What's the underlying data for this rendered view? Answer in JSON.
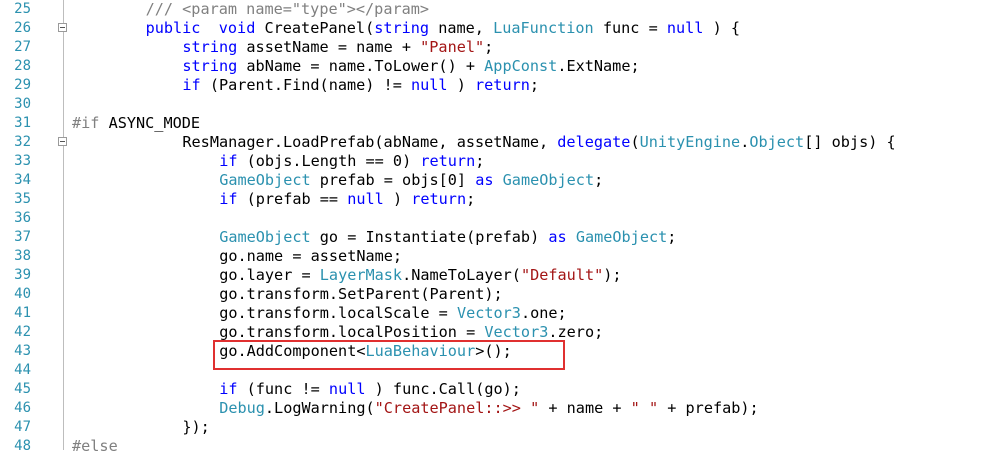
{
  "editor": {
    "lines": [
      {
        "number": "25",
        "indent": 8,
        "fold": false,
        "tokens": [
          [
            "cm",
            "/// <param name=\"type\"></param>"
          ]
        ]
      },
      {
        "number": "26",
        "indent": 8,
        "fold": true,
        "tokens": [
          [
            "kw",
            "public"
          ],
          [
            "",
            "  "
          ],
          [
            "kw",
            "void"
          ],
          [
            "",
            " CreatePanel("
          ],
          [
            "kw",
            "string"
          ],
          [
            "",
            " name, "
          ],
          [
            "ty",
            "LuaFunction"
          ],
          [
            "",
            " func = "
          ],
          [
            "kw",
            "null"
          ],
          [
            "",
            " ) {"
          ]
        ]
      },
      {
        "number": "27",
        "indent": 12,
        "fold": false,
        "tokens": [
          [
            "kw",
            "string"
          ],
          [
            "",
            " assetName = name + "
          ],
          [
            "st",
            "\"Panel\""
          ],
          [
            "",
            ";"
          ]
        ]
      },
      {
        "number": "28",
        "indent": 12,
        "fold": false,
        "tokens": [
          [
            "kw",
            "string"
          ],
          [
            "",
            " abName = name.ToLower() + "
          ],
          [
            "ty",
            "AppConst"
          ],
          [
            "",
            ".ExtName;"
          ]
        ]
      },
      {
        "number": "29",
        "indent": 12,
        "fold": false,
        "tokens": [
          [
            "kw",
            "if"
          ],
          [
            "",
            " (Parent.Find(name) != "
          ],
          [
            "kw",
            "null"
          ],
          [
            "",
            " ) "
          ],
          [
            "kw",
            "return"
          ],
          [
            "",
            ";"
          ]
        ]
      },
      {
        "number": "30",
        "indent": 0,
        "fold": false,
        "tokens": []
      },
      {
        "number": "31",
        "indent": 0,
        "fold": false,
        "tokens": [
          [
            "pp",
            "#if"
          ],
          [
            "",
            " ASYNC_MODE"
          ]
        ]
      },
      {
        "number": "32",
        "indent": 12,
        "fold": true,
        "tokens": [
          [
            "",
            "ResManager.LoadPrefab(abName, assetName, "
          ],
          [
            "kw",
            "delegate"
          ],
          [
            "",
            "("
          ],
          [
            "ty",
            "UnityEngine"
          ],
          [
            "",
            "."
          ],
          [
            "ty",
            "Object"
          ],
          [
            "",
            "[] objs) {"
          ]
        ]
      },
      {
        "number": "33",
        "indent": 16,
        "fold": false,
        "tokens": [
          [
            "kw",
            "if"
          ],
          [
            "",
            " (objs.Length == 0) "
          ],
          [
            "kw",
            "return"
          ],
          [
            "",
            ";"
          ]
        ]
      },
      {
        "number": "34",
        "indent": 16,
        "fold": false,
        "tokens": [
          [
            "ty",
            "GameObject"
          ],
          [
            "",
            " prefab = objs[0] "
          ],
          [
            "kw",
            "as"
          ],
          [
            "",
            ""
          ],
          [
            "ty",
            " GameObject"
          ],
          [
            "",
            ";"
          ]
        ]
      },
      {
        "number": "35",
        "indent": 16,
        "fold": false,
        "tokens": [
          [
            "kw",
            "if"
          ],
          [
            "",
            " (prefab == "
          ],
          [
            "kw",
            "null"
          ],
          [
            "",
            " ) "
          ],
          [
            "kw",
            "return"
          ],
          [
            "",
            ";"
          ]
        ]
      },
      {
        "number": "36",
        "indent": 0,
        "fold": false,
        "tokens": []
      },
      {
        "number": "37",
        "indent": 16,
        "fold": false,
        "tokens": [
          [
            "ty",
            "GameObject"
          ],
          [
            "",
            " go = Instantiate(prefab) "
          ],
          [
            "kw",
            "as"
          ],
          [
            "ty",
            " GameObject"
          ],
          [
            "",
            ";"
          ]
        ]
      },
      {
        "number": "38",
        "indent": 16,
        "fold": false,
        "tokens": [
          [
            "",
            "go.name = assetName;"
          ]
        ]
      },
      {
        "number": "39",
        "indent": 16,
        "fold": false,
        "tokens": [
          [
            "",
            "go.layer = "
          ],
          [
            "ty",
            "LayerMask"
          ],
          [
            "",
            ".NameToLayer("
          ],
          [
            "st",
            "\"Default\""
          ],
          [
            "",
            ");"
          ]
        ]
      },
      {
        "number": "40",
        "indent": 16,
        "fold": false,
        "tokens": [
          [
            "",
            "go.transform.SetParent(Parent);"
          ]
        ]
      },
      {
        "number": "41",
        "indent": 16,
        "fold": false,
        "tokens": [
          [
            "",
            "go.transform.localScale = "
          ],
          [
            "ty",
            "Vector3"
          ],
          [
            "",
            ".one;"
          ]
        ]
      },
      {
        "number": "42",
        "indent": 16,
        "fold": false,
        "tokens": [
          [
            "",
            "go.transform.localPosition = "
          ],
          [
            "ty",
            "Vector3"
          ],
          [
            "",
            ".zero;"
          ]
        ]
      },
      {
        "number": "43",
        "indent": 16,
        "fold": false,
        "tokens": [
          [
            "",
            "go.AddComponent<"
          ],
          [
            "ty",
            "LuaBehaviour"
          ],
          [
            "",
            ">();"
          ]
        ]
      },
      {
        "number": "44",
        "indent": 0,
        "fold": false,
        "tokens": []
      },
      {
        "number": "45",
        "indent": 16,
        "fold": false,
        "tokens": [
          [
            "kw",
            "if"
          ],
          [
            "",
            " (func != "
          ],
          [
            "kw",
            "null"
          ],
          [
            "",
            " ) func.Call(go);"
          ]
        ]
      },
      {
        "number": "46",
        "indent": 16,
        "fold": false,
        "tokens": [
          [
            "ty",
            "Debug"
          ],
          [
            "",
            ".LogWarning("
          ],
          [
            "st",
            "\"CreatePanel::>> \""
          ],
          [
            "",
            " + name + "
          ],
          [
            "st",
            "\" \""
          ],
          [
            "",
            " + prefab);"
          ]
        ]
      },
      {
        "number": "47",
        "indent": 12,
        "fold": false,
        "tokens": [
          [
            "",
            "});"
          ]
        ]
      },
      {
        "number": "48",
        "indent": 0,
        "fold": false,
        "tokens": [
          [
            "pp",
            "#else"
          ]
        ]
      }
    ]
  },
  "colors": {
    "keyword": "#0000ff",
    "type": "#2b91af",
    "string": "#a31515",
    "comment": "#808080",
    "line_number": "#2b91af",
    "highlight_border": "#e03030"
  }
}
